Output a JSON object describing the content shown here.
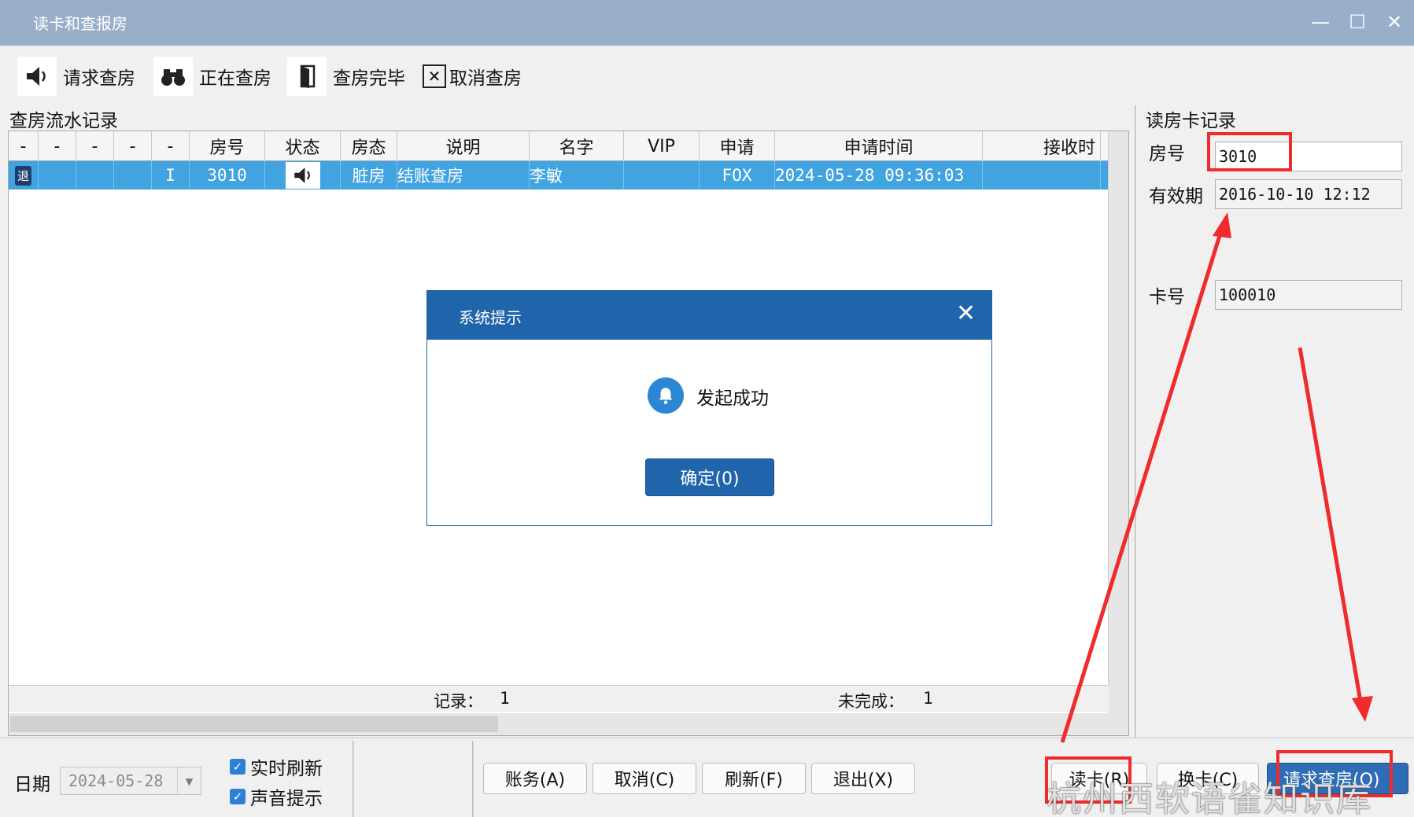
{
  "window": {
    "title": "读卡和查报房",
    "minimize": "—",
    "maximize": "☐",
    "close": "✕"
  },
  "toolbar": {
    "request_checkout": "请求查房",
    "checking": "正在查房",
    "check_done": "查房完毕",
    "cancel_check": "取消查房"
  },
  "grid": {
    "section_title": "查房流水记录",
    "columns": [
      "-",
      "-",
      "-",
      "-",
      "-",
      "房号",
      "状态",
      "房态",
      "说明",
      "名字",
      "VIP",
      "申请",
      "申请时间",
      "接收时"
    ],
    "row": {
      "badge": "退",
      "flag": "I",
      "room": "3010",
      "status_icon": "speaker-icon",
      "room_state": "脏房",
      "note": "结账查房",
      "name": "李敏",
      "vip": "",
      "applicant": "FOX",
      "apply_time": "2024-05-28 09:36:03",
      "receive_time": ""
    },
    "footer": {
      "records_label": "记录：",
      "records_value": "1",
      "unfinished_label": "未完成：",
      "unfinished_value": "1"
    }
  },
  "right_panel": {
    "title": "读房卡记录",
    "room_label": "房号",
    "room_value": "3010",
    "valid_label": "有效期",
    "valid_value": "2016-10-10 12:12",
    "card_label": "卡号",
    "card_value": "100010"
  },
  "dialog": {
    "title": "系统提示",
    "close": "✕",
    "message": "发起成功",
    "ok_button": "确定(0)"
  },
  "bottom": {
    "date_label": "日期",
    "date_value": "2024-05-28",
    "realtime_refresh": "实时刷新",
    "sound_prompt": "声音提示",
    "realtime_checked": true,
    "sound_checked": true,
    "btn_account": "账务(A)",
    "btn_cancel": "取消(C)",
    "btn_refresh": "刷新(F)",
    "btn_exit": "退出(X)",
    "btn_read_card": "读卡(R)",
    "btn_write_card": "换卡(C)",
    "btn_request_check": "请求查房(Q)"
  },
  "watermark": "杭州西软语雀知识库",
  "colors": {
    "titlebar": "#99aec9",
    "selected_row": "#41a3e0",
    "dialog_header": "#2065ac",
    "annotation_red": "#ef2b2b"
  }
}
